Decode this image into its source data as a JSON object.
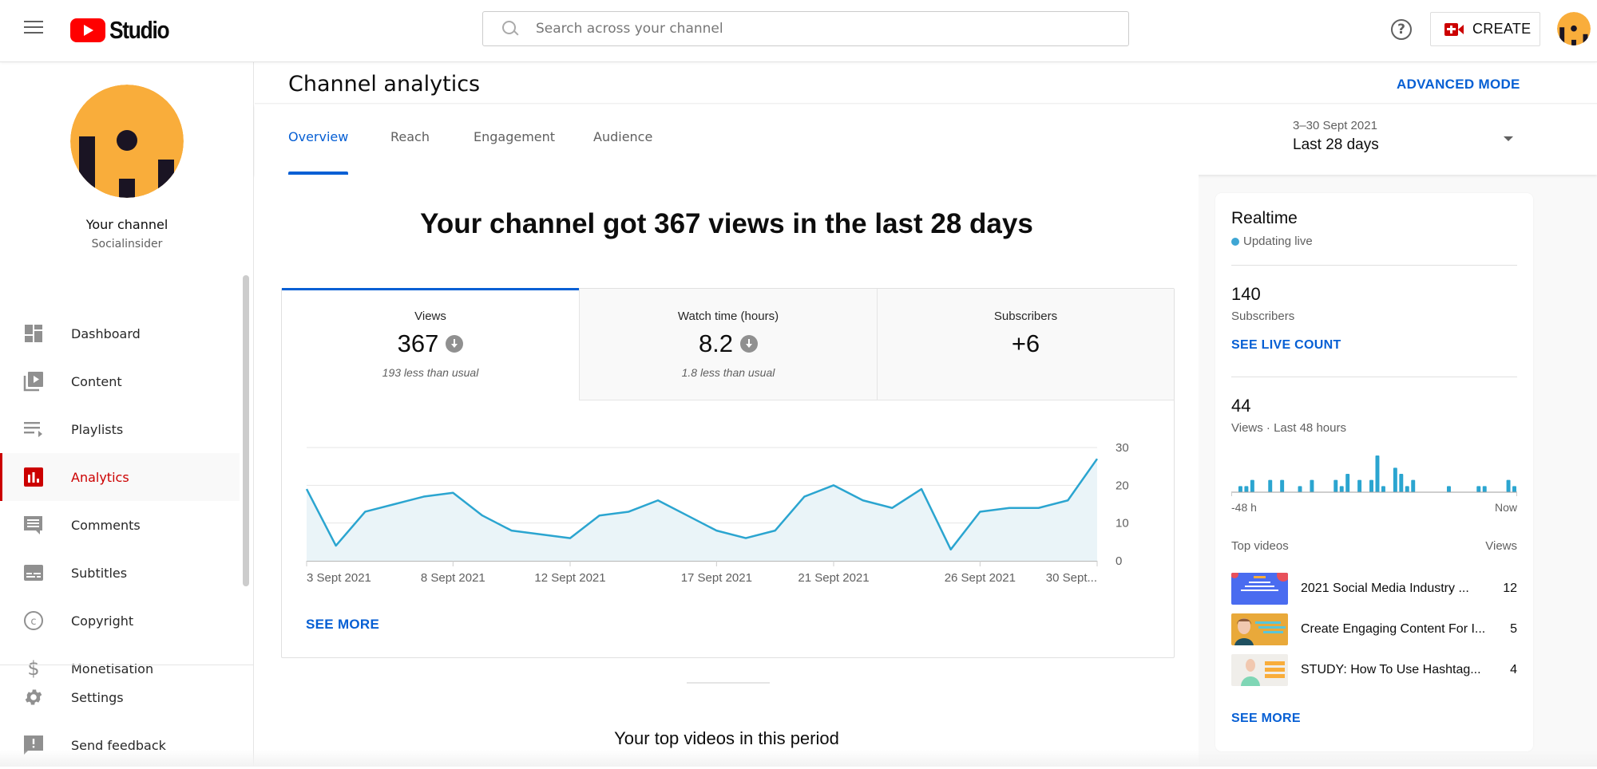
{
  "app": {
    "logo_text": "Studio",
    "search_placeholder": "Search across your channel",
    "create_label": "CREATE"
  },
  "sidebar": {
    "channel_name": "Your channel",
    "channel_handle": "Socialinsider",
    "items": [
      {
        "label": "Dashboard",
        "icon": "dashboard-icon"
      },
      {
        "label": "Content",
        "icon": "content-icon"
      },
      {
        "label": "Playlists",
        "icon": "playlists-icon"
      },
      {
        "label": "Analytics",
        "icon": "analytics-icon",
        "active": true
      },
      {
        "label": "Comments",
        "icon": "comments-icon"
      },
      {
        "label": "Subtitles",
        "icon": "subtitles-icon"
      },
      {
        "label": "Copyright",
        "icon": "copyright-icon"
      },
      {
        "label": "Monetisation",
        "icon": "monetisation-icon"
      }
    ],
    "bottom_items": [
      {
        "label": "Settings",
        "icon": "gear-icon"
      },
      {
        "label": "Send feedback",
        "icon": "feedback-icon"
      }
    ]
  },
  "page": {
    "title": "Channel analytics",
    "advanced_mode": "ADVANCED MODE",
    "tabs": [
      "Overview",
      "Reach",
      "Engagement",
      "Audience"
    ],
    "active_tab": "Overview",
    "date_range": "3–30 Sept 2021",
    "date_period": "Last 28 days"
  },
  "overview": {
    "headline": "Your channel got 367 views in the last 28 days",
    "metrics": [
      {
        "label": "Views",
        "value": "367",
        "trend": "down",
        "note": "193 less than usual"
      },
      {
        "label": "Watch time (hours)",
        "value": "8.2",
        "trend": "down",
        "note": "1.8 less than usual"
      },
      {
        "label": "Subscribers",
        "value": "+6",
        "trend": "",
        "note": ""
      }
    ],
    "see_more": "SEE MORE",
    "top_videos_title": "Your top videos in this period"
  },
  "chart_data": [
    {
      "type": "area",
      "title": "Views",
      "x": [
        "3 Sept 2021",
        "4 Sept 2021",
        "5 Sept 2021",
        "6 Sept 2021",
        "7 Sept 2021",
        "8 Sept 2021",
        "9 Sept 2021",
        "10 Sept 2021",
        "11 Sept 2021",
        "12 Sept 2021",
        "13 Sept 2021",
        "14 Sept 2021",
        "15 Sept 2021",
        "16 Sept 2021",
        "17 Sept 2021",
        "18 Sept 2021",
        "19 Sept 2021",
        "20 Sept 2021",
        "21 Sept 2021",
        "22 Sept 2021",
        "23 Sept 2021",
        "24 Sept 2021",
        "25 Sept 2021",
        "26 Sept 2021",
        "27 Sept 2021",
        "28 Sept 2021",
        "29 Sept 2021",
        "30 Sept 2021"
      ],
      "values": [
        19,
        4,
        13,
        15,
        17,
        18,
        12,
        8,
        7,
        6,
        12,
        13,
        16,
        12,
        8,
        6,
        8,
        17,
        20,
        16,
        14,
        19,
        3,
        13,
        14,
        14,
        16,
        27
      ],
      "x_tick_labels": [
        {
          "index": 0,
          "label": "3 Sept 2021"
        },
        {
          "index": 5,
          "label": "8 Sept 2021"
        },
        {
          "index": 9,
          "label": "12 Sept 2021"
        },
        {
          "index": 14,
          "label": "17 Sept 2021"
        },
        {
          "index": 18,
          "label": "21 Sept 2021"
        },
        {
          "index": 23,
          "label": "26 Sept 2021"
        },
        {
          "index": 27,
          "label": "30 Sept..."
        }
      ],
      "y_ticks": [
        0,
        10,
        20,
        30
      ],
      "ylim": [
        0,
        30
      ],
      "y_axis_side": "right",
      "grid": true,
      "line_color": "#2ba5d0",
      "fill_color": "#eaf4f8"
    },
    {
      "type": "bar",
      "title": "Views · Last 48 hours",
      "x_start_label": "-48 h",
      "x_end_label": "Now",
      "values": [
        0,
        1,
        1,
        2,
        0,
        0,
        2,
        0,
        2,
        0,
        0,
        1,
        0,
        2,
        0,
        0,
        0,
        2,
        1,
        3,
        0,
        2,
        0,
        2,
        6,
        1,
        0,
        4,
        3,
        1,
        2,
        0,
        0,
        0,
        0,
        0,
        1,
        0,
        0,
        0,
        0,
        1,
        1,
        0,
        0,
        0,
        2,
        1
      ],
      "color": "#2ba5d0"
    }
  ],
  "realtime": {
    "title": "Realtime",
    "status": "Updating live",
    "status_color": "#3ea6d4",
    "subscribers_value": "140",
    "subscribers_label": "Subscribers",
    "see_live_count": "SEE LIVE COUNT",
    "views_value": "44",
    "views_label": "Views · Last 48 hours",
    "axis_start": "-48 h",
    "axis_end": "Now",
    "top_videos_label": "Top videos",
    "views_col_label": "Views",
    "videos": [
      {
        "title": "2021 Social Media Industry ...",
        "views": "12"
      },
      {
        "title": "Create Engaging Content For I...",
        "views": "5"
      },
      {
        "title": "STUDY: How To Use Hashtag...",
        "views": "4"
      }
    ],
    "see_more": "SEE MORE"
  },
  "colors": {
    "accent_blue": "#065fd4",
    "brand_red": "#cc0000",
    "avatar_orange": "#f9ad3b",
    "avatar_dark": "#1a1423"
  }
}
